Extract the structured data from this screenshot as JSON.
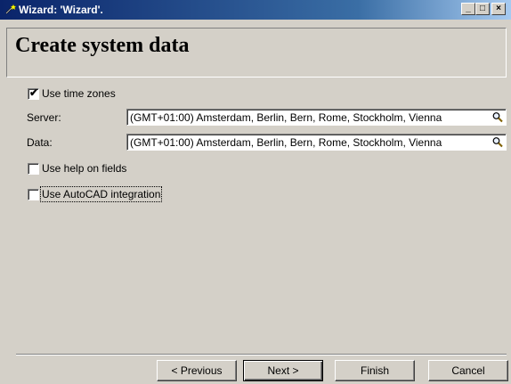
{
  "window": {
    "title": "Wizard: 'Wizard'.",
    "min_glyph": "_",
    "max_glyph": "□",
    "close_glyph": "×"
  },
  "header": {
    "title": "Create system data"
  },
  "options": {
    "use_time_zones": {
      "label": "Use time zones",
      "checked": true,
      "tick": "✔"
    },
    "use_help_on_fields": {
      "label": "Use help on fields",
      "checked": false
    },
    "use_autocad": {
      "label": "Use AutoCAD integration",
      "checked": false
    }
  },
  "fields": {
    "server": {
      "label": "Server:",
      "value": "(GMT+01:00) Amsterdam, Berlin, Bern, Rome, Stockholm, Vienna"
    },
    "data": {
      "label": "Data:",
      "value": "(GMT+01:00) Amsterdam, Berlin, Bern, Rome, Stockholm, Vienna"
    }
  },
  "buttons": {
    "previous": "< Previous",
    "next": "Next >",
    "finish": "Finish",
    "cancel": "Cancel"
  },
  "colors": {
    "titlebar_start": "#0a246a",
    "titlebar_end": "#a6caf0",
    "face": "#d4d0c8"
  },
  "icons": {
    "title": "wizard-wand-icon",
    "lookup": "magnifier-icon"
  }
}
